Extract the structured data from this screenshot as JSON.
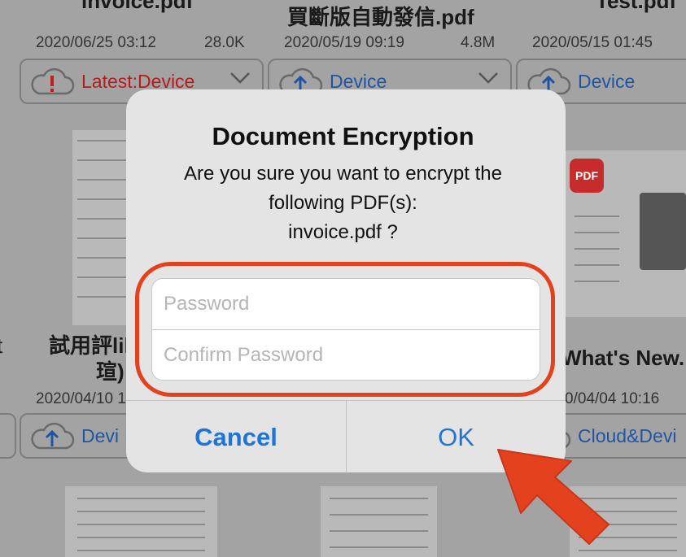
{
  "files": [
    {
      "name": "invoice.pdf",
      "date": "2020/06/25 03:12",
      "size": "28.0K",
      "status": "Latest:Device",
      "status_kind": "warning"
    },
    {
      "name": "買斷版自動發信.pdf",
      "date": "2020/05/19 09:19",
      "size": "4.8M",
      "status": "Device",
      "status_kind": "upload"
    },
    {
      "name": "Test.pdf",
      "date": "2020/05/15 01:45",
      "size": "",
      "status": "Device",
      "status_kind": "upload"
    }
  ],
  "row2": {
    "left_name_line1": "試用評likely",
    "left_name_line2": "瑄)",
    "left_date": "2020/04/10 1",
    "left_status": "Devi",
    "right_name": "What's New.",
    "right_date": "0/04/04 10:16",
    "right_status": "Cloud&Devi",
    "edge_glyph": "t",
    "pdf_logo_text": "PDF"
  },
  "dialog": {
    "title": "Document Encryption",
    "message_line1": "Are you sure you want to encrypt the",
    "message_line2": "following PDF(s):",
    "message_line3": "invoice.pdf ?",
    "password_placeholder": "Password",
    "confirm_placeholder": "Confirm Password",
    "cancel_label": "Cancel",
    "ok_label": "OK"
  },
  "colors": {
    "accent": "#1f74d8",
    "warning": "#b81b1b",
    "highlight": "#e4421e",
    "arrow": "#e4421e"
  }
}
